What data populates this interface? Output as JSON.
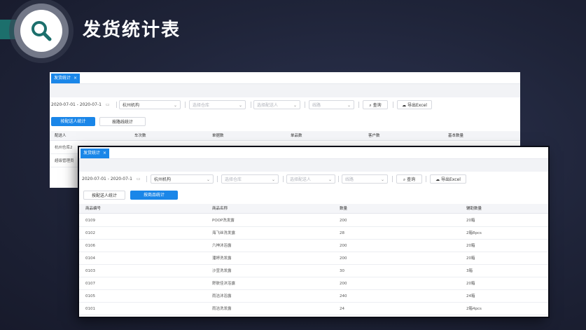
{
  "slide": {
    "title": "发货统计表"
  },
  "back": {
    "tab_label": "发货统计",
    "tab_close": "×",
    "date_range": "2020-07-01 - 2020-07-1",
    "org_value": "杭州机构",
    "warehouse_placeholder": "选择仓库",
    "deliverer_placeholder": "选择配送人",
    "route_placeholder": "线路",
    "search_label": "查询",
    "export_label": "导出Excel",
    "mode_tabs": [
      "按配送人统计",
      "按路线统计"
    ],
    "columns": [
      "配送人",
      "车次数",
      "单据数",
      "单品数",
      "客户数",
      "基本数量"
    ],
    "rows": [
      [
        "杭州仓库2"
      ],
      [
        "超级管理员"
      ]
    ]
  },
  "front": {
    "tab_label": "发货统计",
    "date_range": "2020-07-01 - 2020-07-1",
    "org_value": "杭州机构",
    "warehouse_placeholder": "选择仓库",
    "deliverer_placeholder": "选择配送人",
    "route_placeholder": "线路",
    "search_label": "查询",
    "export_label": "导出Excel",
    "mode_tabs": [
      "按配送人统计",
      "按商品统计"
    ],
    "columns": [
      "商品编号",
      "商品名称",
      "数量",
      "辅助数量"
    ],
    "rows": [
      [
        "0109",
        "POOP洗发露",
        "200",
        "20箱"
      ],
      [
        "0102",
        "海飞丝洗发露",
        "28",
        "2箱8pcs"
      ],
      [
        "0106",
        "六神沐浴露",
        "200",
        "20箱"
      ],
      [
        "0104",
        "潘婷洗发露",
        "200",
        "20箱"
      ],
      [
        "0103",
        "沙宣洗发露",
        "30",
        "3箱"
      ],
      [
        "0107",
        "舒肤佳沐浴露",
        "200",
        "20箱"
      ],
      [
        "0105",
        "雨洁沐浴露",
        "240",
        "24箱"
      ],
      [
        "0101",
        "雨洁洗发露",
        "24",
        "2箱4pcs"
      ]
    ]
  },
  "colors": {
    "accent": "#1a86e8",
    "banner": "#1c6f6c",
    "background": "#1f2439"
  },
  "icons": [
    "search-icon",
    "calendar-icon",
    "cloud-download-icon",
    "chevron-down-icon",
    "close-icon"
  ]
}
